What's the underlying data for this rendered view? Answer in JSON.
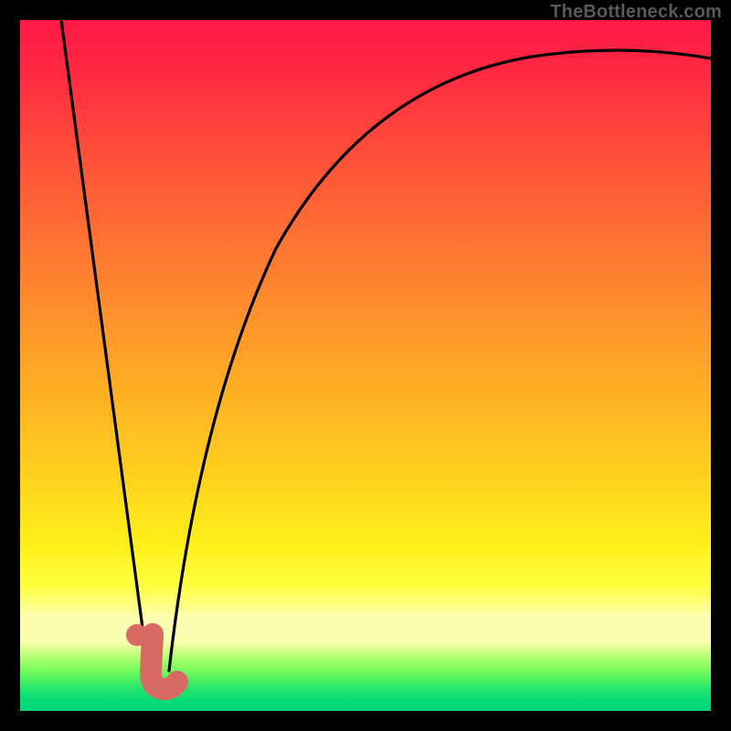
{
  "attribution": "TheBottleneck.com",
  "chart_data": {
    "type": "line",
    "title": "",
    "xlabel": "",
    "ylabel": "",
    "xlim": [
      0,
      100
    ],
    "ylim": [
      0,
      100
    ],
    "background_gradient": {
      "top": "#ff1846",
      "upper_mid": "#ff8f2c",
      "mid": "#ffd11e",
      "lower": "#fdffb0",
      "bottom": "#02d67a"
    },
    "series": [
      {
        "name": "left-limb",
        "stroke": "#000000",
        "x": [
          6,
          8,
          10,
          12,
          14,
          15,
          16,
          17,
          18,
          18.5
        ],
        "values": [
          100,
          87,
          74,
          61,
          48,
          41,
          34,
          24,
          14,
          6
        ]
      },
      {
        "name": "right-limb",
        "stroke": "#000000",
        "x": [
          21.5,
          23,
          25,
          28,
          32,
          38,
          46,
          56,
          70,
          85,
          100
        ],
        "values": [
          6,
          18,
          32,
          47,
          60,
          71,
          80,
          86,
          90.5,
          93,
          94.5
        ]
      }
    ],
    "annotations": [
      {
        "name": "marker-dot",
        "shape": "circle",
        "color": "#d86a63",
        "cx": 16.9,
        "cy": 11,
        "r": 1.6
      },
      {
        "name": "marker-hook",
        "shape": "path",
        "color": "#d86a63",
        "points_x": [
          19.2,
          19.0,
          19.3,
          20.3,
          22.0
        ],
        "points_y": [
          11.0,
          5.5,
          3.6,
          3.2,
          4.2
        ]
      }
    ]
  }
}
